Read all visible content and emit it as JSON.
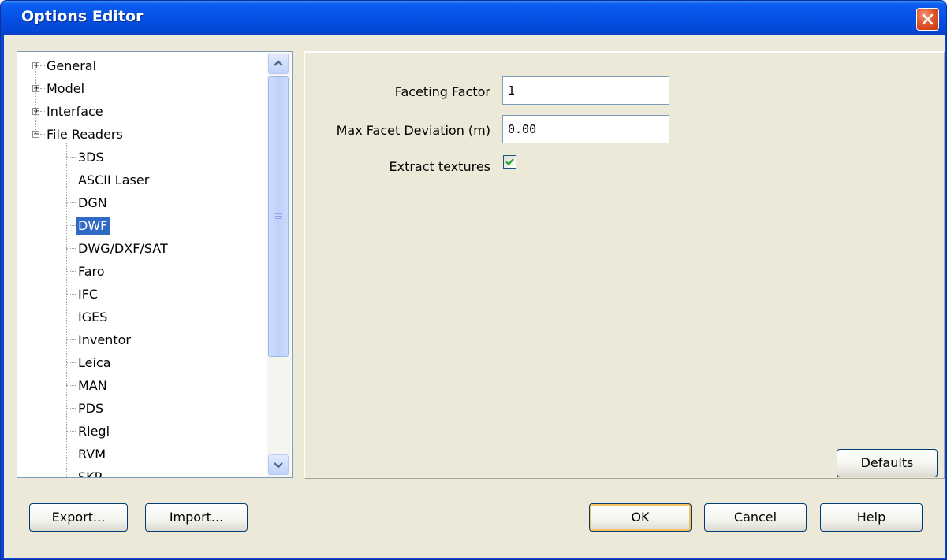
{
  "window": {
    "title": "Options Editor"
  },
  "tree": {
    "items": [
      {
        "label": "General",
        "level": 0,
        "expander": "+"
      },
      {
        "label": "Model",
        "level": 0,
        "expander": "+"
      },
      {
        "label": "Interface",
        "level": 0,
        "expander": "+"
      },
      {
        "label": "File Readers",
        "level": 0,
        "expander": "−"
      },
      {
        "label": "3DS",
        "level": 1
      },
      {
        "label": "ASCII Laser",
        "level": 1
      },
      {
        "label": "DGN",
        "level": 1
      },
      {
        "label": "DWF",
        "level": 1,
        "selected": true
      },
      {
        "label": "DWG/DXF/SAT",
        "level": 1
      },
      {
        "label": "Faro",
        "level": 1
      },
      {
        "label": "IFC",
        "level": 1
      },
      {
        "label": "IGES",
        "level": 1
      },
      {
        "label": "Inventor",
        "level": 1
      },
      {
        "label": "Leica",
        "level": 1
      },
      {
        "label": "MAN",
        "level": 1
      },
      {
        "label": "PDS",
        "level": 1
      },
      {
        "label": "Riegl",
        "level": 1
      },
      {
        "label": "RVM",
        "level": 1
      },
      {
        "label": "SKP",
        "level": 1
      }
    ]
  },
  "settings": {
    "faceting_factor": {
      "label": "Faceting Factor",
      "value": "1"
    },
    "max_facet_deviation": {
      "label": "Max Facet Deviation (m)",
      "value": "0.00"
    },
    "extract_textures": {
      "label": "Extract textures",
      "checked": true
    },
    "defaults_label": "Defaults"
  },
  "footer": {
    "export_label": "Export...",
    "import_label": "Import...",
    "ok_label": "OK",
    "cancel_label": "Cancel",
    "help_label": "Help"
  }
}
